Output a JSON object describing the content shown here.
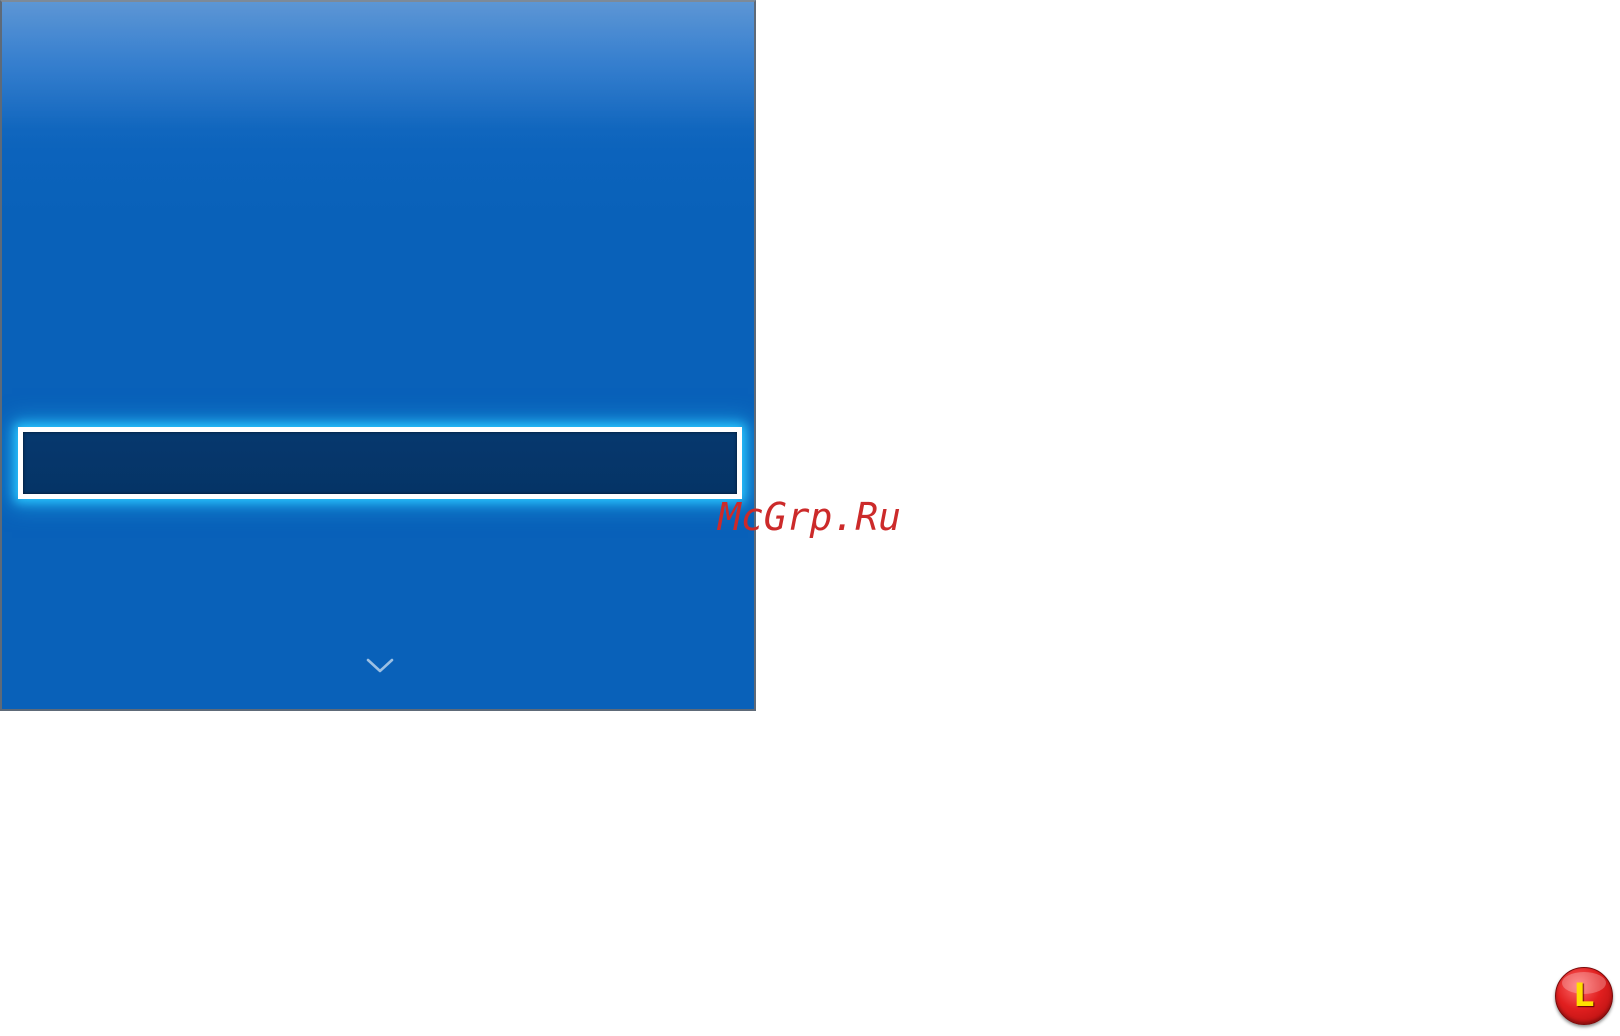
{
  "screen": {
    "selected_item": {
      "label": ""
    },
    "scroll_down_icon": "chevron-down-icon"
  },
  "watermark": {
    "text": "McGrp.Ru"
  },
  "corner_badge": {
    "letter": "L",
    "color": "#e11f1f",
    "letter_color": "#ffe000"
  },
  "colors": {
    "panel_blue": "#0961b9",
    "selected_bg": "#053466",
    "highlight_glow": "#29c6ff"
  }
}
